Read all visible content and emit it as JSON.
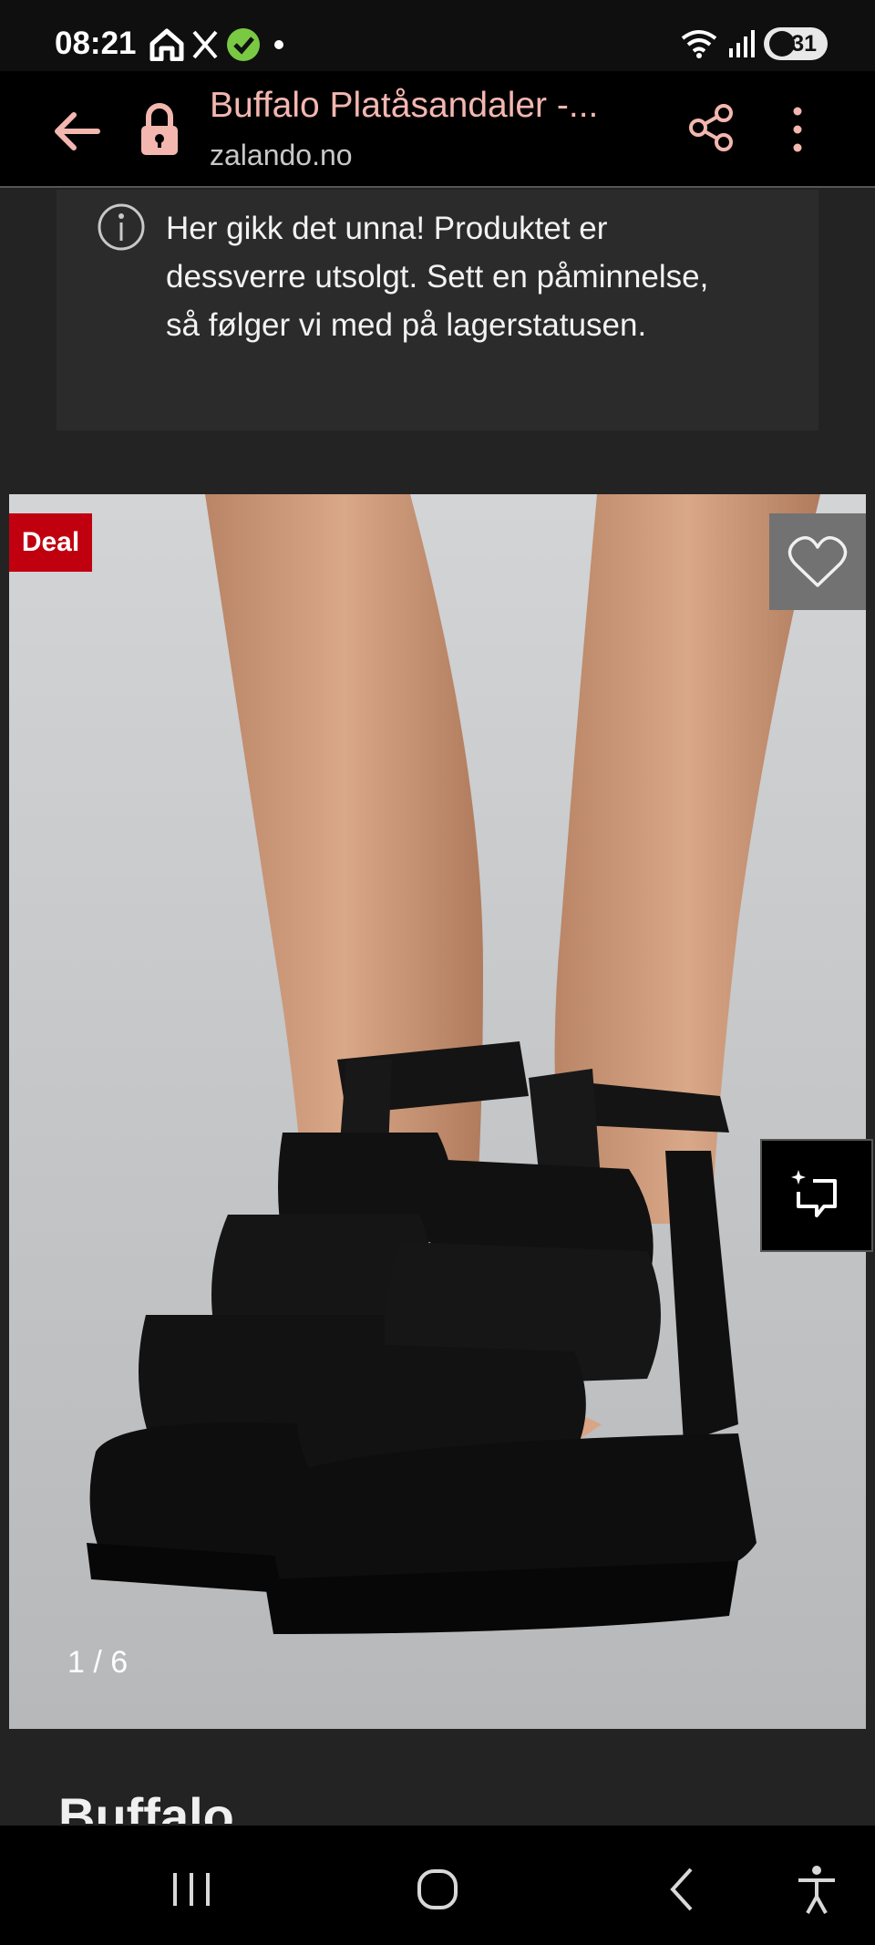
{
  "status_bar": {
    "time": "08:21",
    "icons": [
      "home-icon",
      "x-icon",
      "check-circle-icon",
      "dot-icon"
    ],
    "right_icons": [
      "wifi-icon",
      "signal-icon"
    ],
    "battery": "31"
  },
  "browser": {
    "page_title": "Buffalo Platåsandaler -...",
    "domain": "zalando.no"
  },
  "notice": {
    "text": "Her gikk det unna! Produktet er dessverre utsolgt. Sett en påminnelse, så følger vi med på lagerstatusen."
  },
  "product": {
    "badge": "Deal",
    "image_counter": "1 / 6",
    "brand": "Buffalo"
  },
  "colors": {
    "accent": "#f3b7b0",
    "deal_badge": "#c0000f",
    "background": "#232323"
  },
  "navigation": [
    "recent-apps-icon",
    "home-icon",
    "back-icon",
    "accessibility-icon"
  ]
}
